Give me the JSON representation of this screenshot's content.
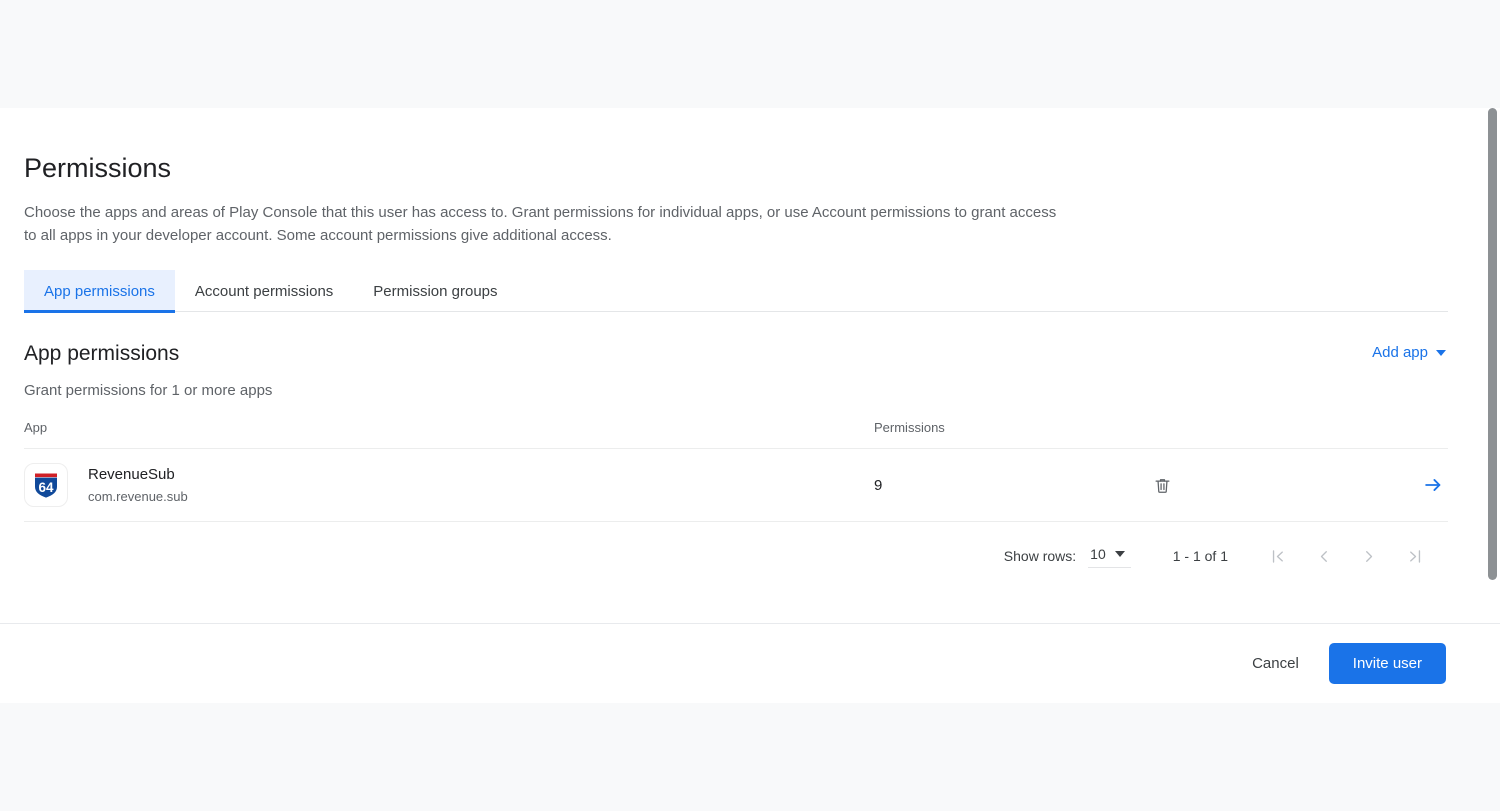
{
  "dialog": {
    "title": "Permissions",
    "description": "Choose the apps and areas of Play Console that this user has access to. Grant permissions for individual apps, or use Account permissions to grant access to all apps in your developer account. Some account permissions give additional access."
  },
  "tabs": [
    {
      "label": "App permissions",
      "active": true
    },
    {
      "label": "Account permissions",
      "active": false
    },
    {
      "label": "Permission groups",
      "active": false
    }
  ],
  "section": {
    "title": "App permissions",
    "subtitle": "Grant permissions for 1 or more apps",
    "add_app_label": "Add app",
    "add_app_icon": "chevron-down-icon"
  },
  "table": {
    "headers": [
      "App",
      "Permissions",
      "",
      ""
    ],
    "rows": [
      {
        "app_name": "RevenueSub",
        "app_package": "com.revenue.sub",
        "app_icon": "interstate-shield-64-icon",
        "permissions_count": "9",
        "delete_icon": "trash-icon",
        "go_icon": "arrow-right-icon"
      }
    ]
  },
  "paginator": {
    "show_rows_label": "Show rows:",
    "rows_per_page": "10",
    "rows_dropdown_icon": "chevron-down-icon",
    "range_label": "1 - 1 of 1",
    "first_page_icon": "first-page-icon",
    "prev_page_icon": "prev-page-icon",
    "next_page_icon": "next-page-icon",
    "last_page_icon": "last-page-icon"
  },
  "footer": {
    "cancel_label": "Cancel",
    "invite_label": "Invite user"
  },
  "colors": {
    "accent": "#1a73e8",
    "active_tab_bg": "#e8f0fe",
    "page_bg": "#f8f9fa",
    "panel_bg": "#ffffff",
    "text_primary": "#202124",
    "text_secondary": "#5f6368",
    "divider": "#eceded",
    "disabled_icon": "#bdc1c6",
    "scrollbar_thumb": "#8d9194"
  }
}
